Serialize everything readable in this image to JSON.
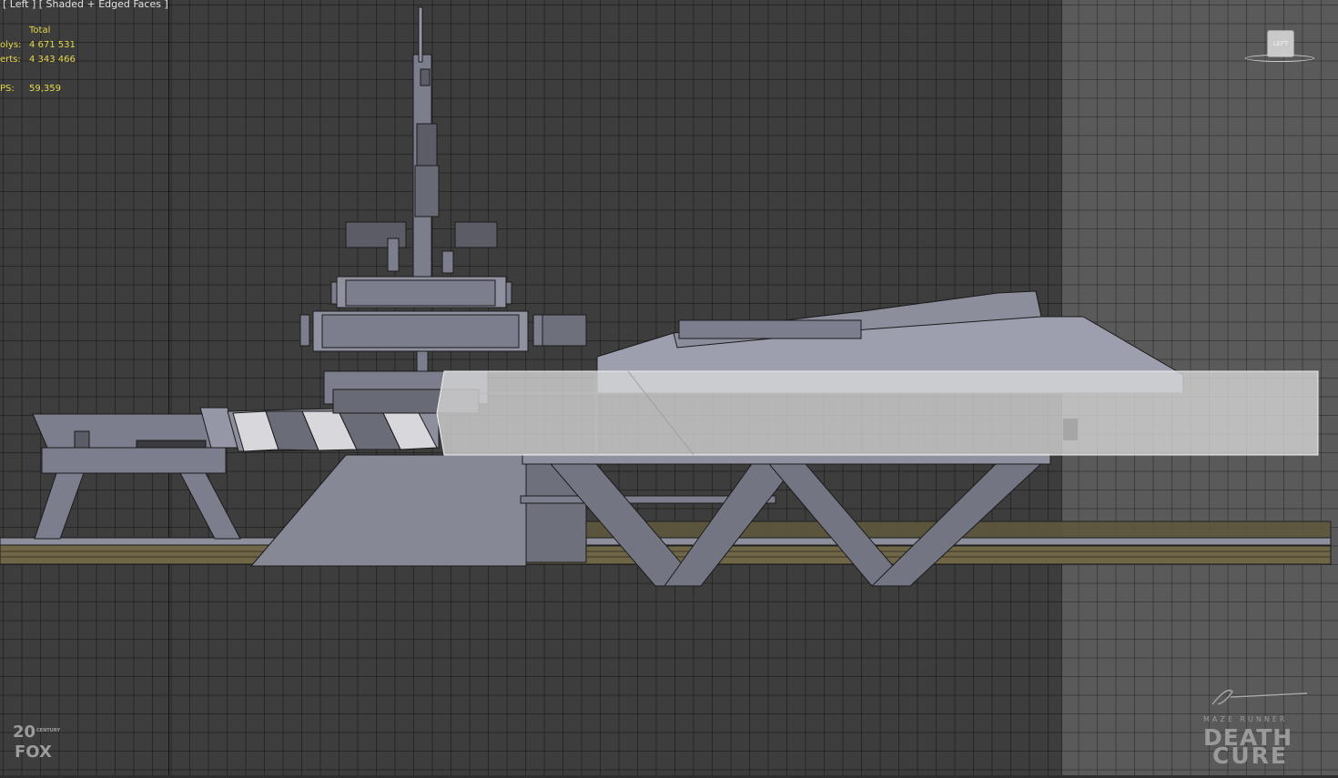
{
  "viewport": {
    "label": "[ Left ] [ Shaded + Edged Faces ]",
    "stats": {
      "header": "Total",
      "polys_label": "olys:",
      "polys_value": "4 671 531",
      "verts_label": "erts:",
      "verts_value": "4 343 466",
      "fps_label": "PS:",
      "fps_value": "59,359"
    },
    "viewcube_label": "LEFT"
  },
  "watermarks": {
    "studio_line1": "20",
    "studio_line2": "CENTURY",
    "studio_line3": "FOX",
    "signature": "ZABROCKI",
    "film_subtitle": "MAZE RUNNER",
    "film_title_line1": "DEATH",
    "film_title_line2": "CURE"
  },
  "colors": {
    "viewport_bg": "#3d3d3d",
    "side_region_bg": "#5a5a5a",
    "stats_text": "#e6d84a",
    "model_face": "#7c7e8e",
    "model_edge": "#1b1b1b",
    "selected_box": "#cfcfcf",
    "ground": "#6e6647"
  }
}
